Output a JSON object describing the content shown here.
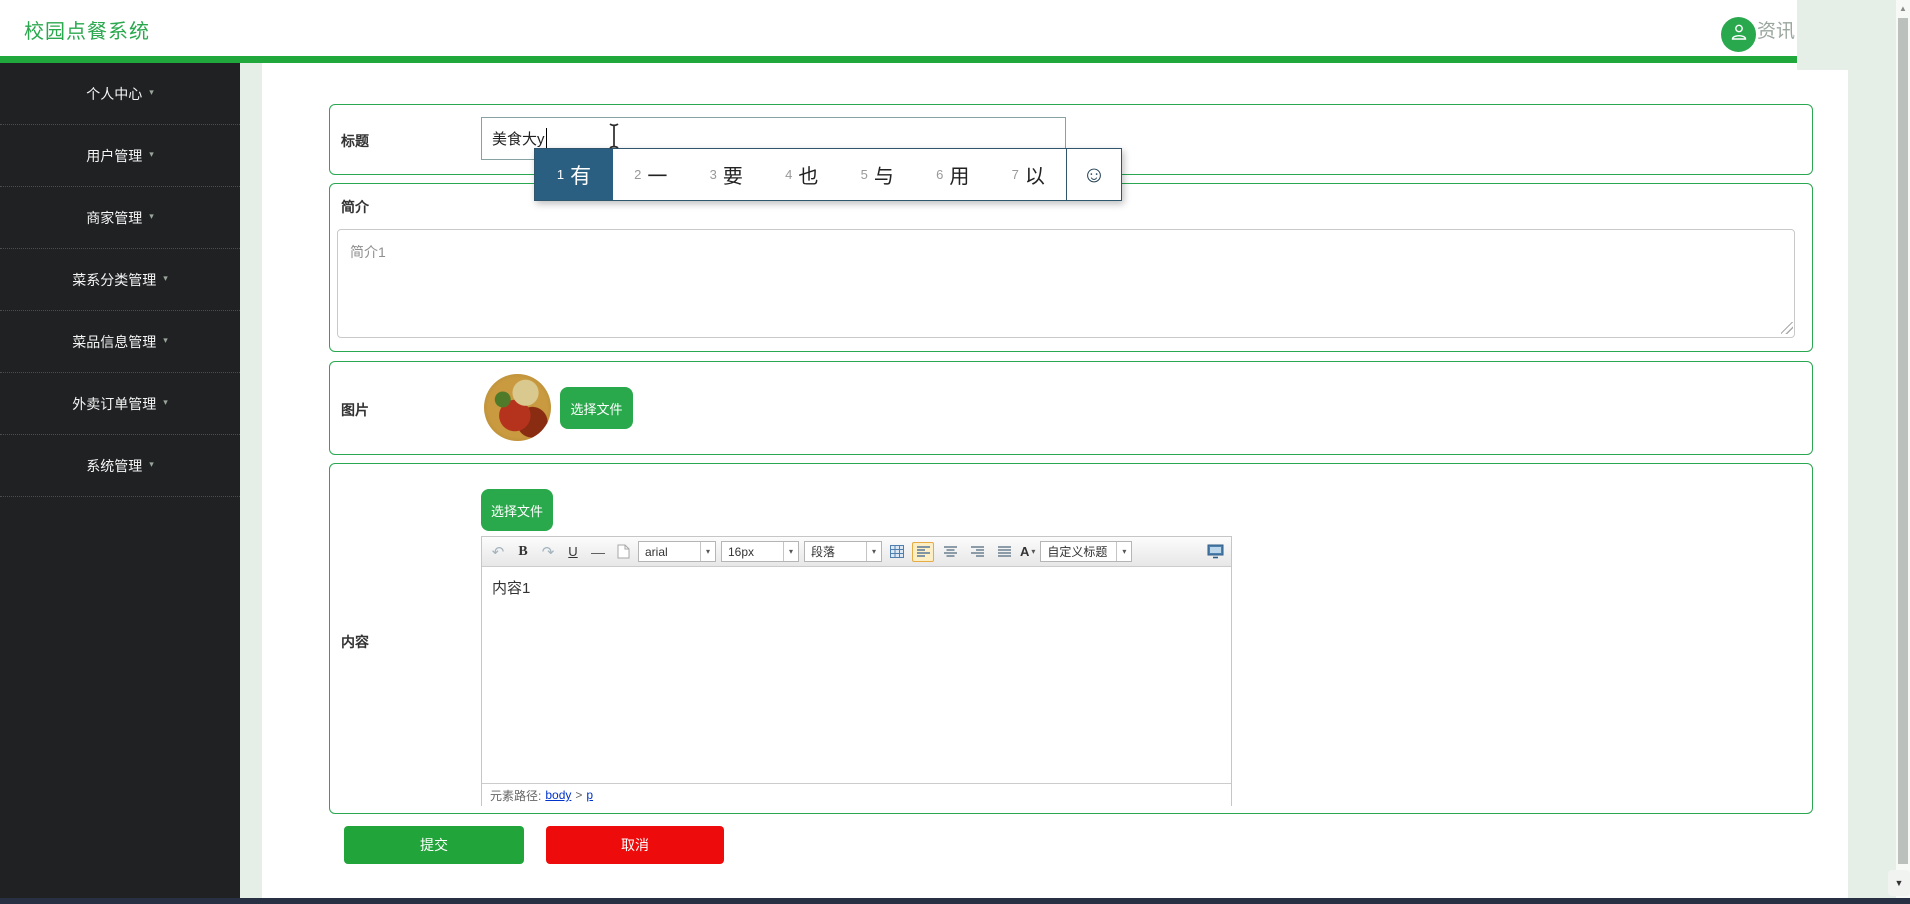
{
  "header": {
    "title": "校园点餐系统",
    "clipped_text": "资讯"
  },
  "icons": {
    "caret_down": "▾",
    "smiley": "☺",
    "undo": "↶",
    "redo": "↷",
    "scroll_up": "▲",
    "scroll_down": "▼"
  },
  "sidebar": {
    "items": [
      {
        "label": "个人中心"
      },
      {
        "label": "用户管理"
      },
      {
        "label": "商家管理"
      },
      {
        "label": "菜系分类管理"
      },
      {
        "label": "菜品信息管理"
      },
      {
        "label": "外卖订单管理"
      },
      {
        "label": "系统管理"
      }
    ]
  },
  "ime": {
    "selected": {
      "num": "1",
      "char": "有"
    },
    "candidates": [
      {
        "num": "2",
        "char": "一"
      },
      {
        "num": "3",
        "char": "要"
      },
      {
        "num": "4",
        "char": "也"
      },
      {
        "num": "5",
        "char": "与"
      },
      {
        "num": "6",
        "char": "用"
      },
      {
        "num": "7",
        "char": "以"
      }
    ]
  },
  "form": {
    "title": {
      "label": "标题",
      "value": "美食大y"
    },
    "intro": {
      "label": "简介",
      "value": "简介1"
    },
    "image": {
      "label": "图片",
      "choose_file": "选择文件"
    },
    "content": {
      "label": "内容",
      "choose_file": "选择文件",
      "text": "内容1"
    },
    "submit_label": "提交",
    "cancel_label": "取消"
  },
  "editor": {
    "bold": "B",
    "underline": "U",
    "dash": "—",
    "font_select": "arial",
    "size_select": "16px",
    "paragraph_select": "段落",
    "custom_select": "自定义标题",
    "color_letter": "A",
    "path_label": "元素路径:",
    "path_body": "body",
    "path_sep": ">",
    "path_p": "p"
  },
  "colors": {
    "brand_green": "#21a83c",
    "button_green": "#2aa94c",
    "cancel_red": "#ee0b0b",
    "ime_highlight_blue": "#2a5f81",
    "sidebar_dark": "#1f2123"
  }
}
